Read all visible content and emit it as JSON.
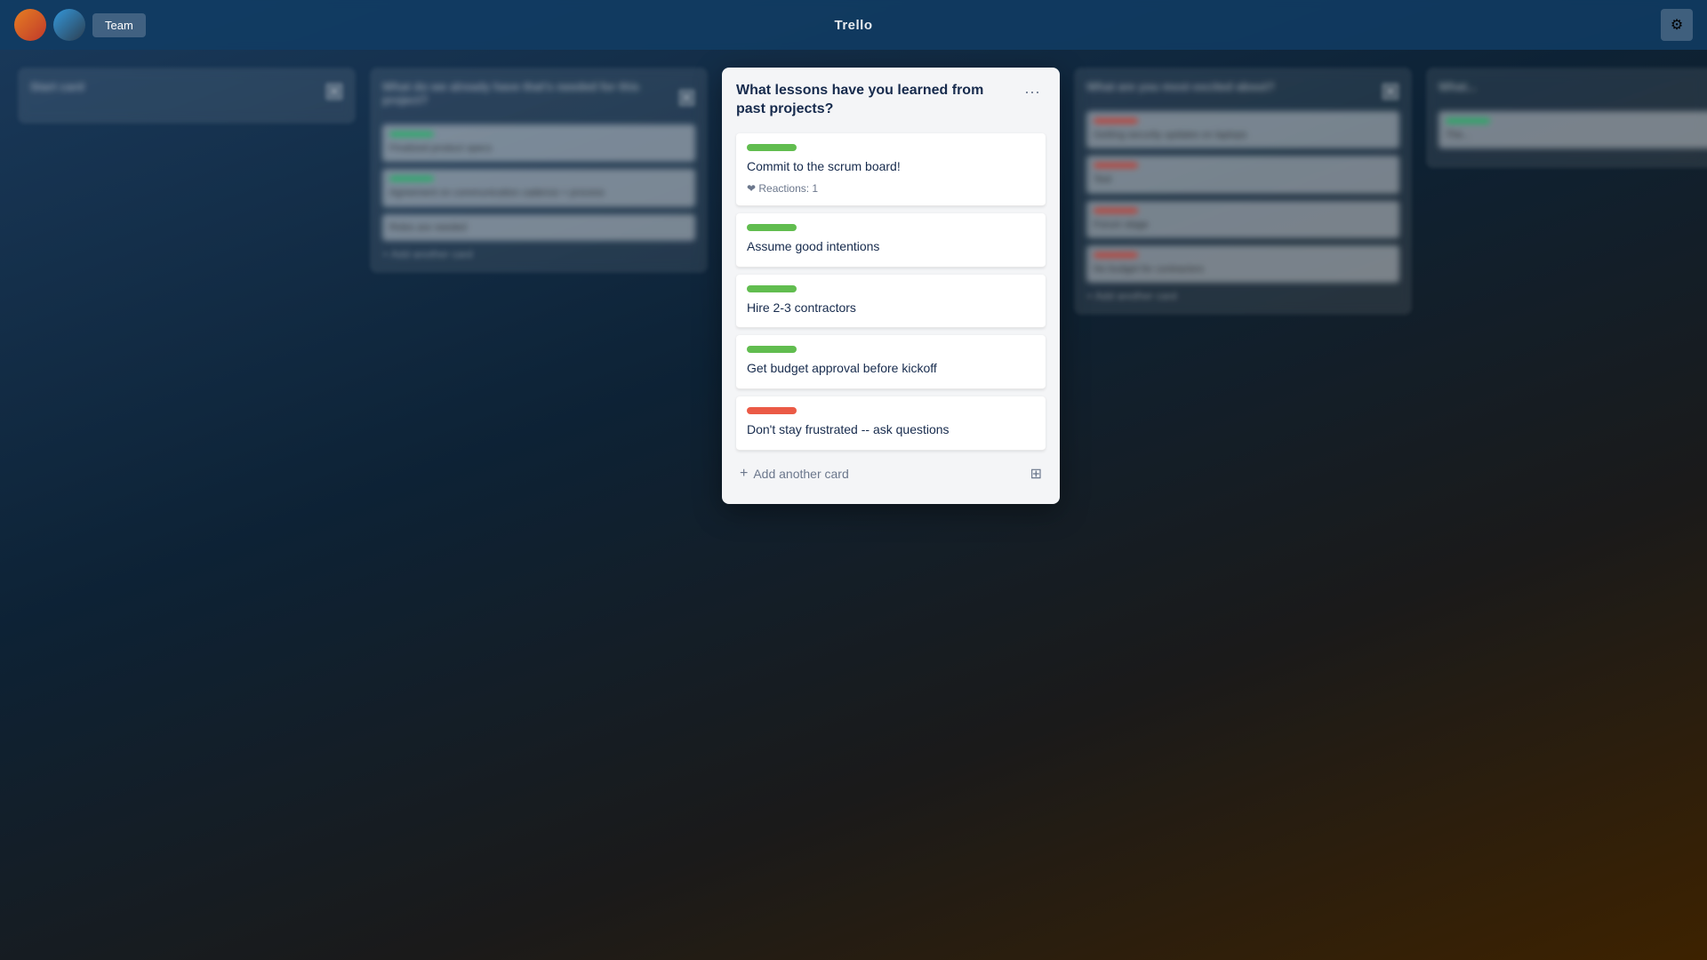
{
  "app": {
    "title": "Trello"
  },
  "topbar": {
    "title": "Trello",
    "left_btn_label": "Team",
    "right_icon": "⚙"
  },
  "focused_column": {
    "title": "What lessons have you learned from past projects?",
    "menu_icon": "···",
    "cards": [
      {
        "id": "card-1",
        "label_color": "green",
        "text": "Commit to the scrum board!",
        "reactions": "❤ Reactions: 1"
      },
      {
        "id": "card-2",
        "label_color": "green",
        "text": "Assume good intentions",
        "reactions": null
      },
      {
        "id": "card-3",
        "label_color": "green",
        "text": "Hire 2-3 contractors",
        "reactions": null
      },
      {
        "id": "card-4",
        "label_color": "green",
        "text": "Get budget approval before kickoff",
        "reactions": null
      },
      {
        "id": "card-5",
        "label_color": "red",
        "text": "Don't stay frustrated -- ask questions",
        "reactions": null
      }
    ],
    "add_card_label": "Add another card",
    "template_icon": "⊞"
  },
  "left_column": {
    "title": "What do we already have that's needed for this project?",
    "cards": [
      {
        "label_color": "green",
        "text": "Finalized product specs"
      },
      {
        "label_color": "green",
        "text": "Agreement on communication cadence + process"
      },
      {
        "text": "Roles are needed"
      }
    ],
    "add_label": "+ Add another card"
  },
  "right_column": {
    "title": "What are you most excited about?",
    "cards": [
      {
        "label_color": "red",
        "text": "Getting security updates on laptops"
      },
      {
        "label_color": "red",
        "text": "Test"
      },
      {
        "label_color": "red",
        "text": "Forum stage"
      },
      {
        "label_color": "red",
        "text": "No budget for contractors"
      }
    ],
    "add_label": "+ Add another card"
  },
  "far_left_column": {
    "title": "Start card",
    "cards": []
  },
  "far_right_column": {
    "title": "What...",
    "cards": [
      {
        "label_color": "green",
        "text": "The..."
      }
    ]
  }
}
